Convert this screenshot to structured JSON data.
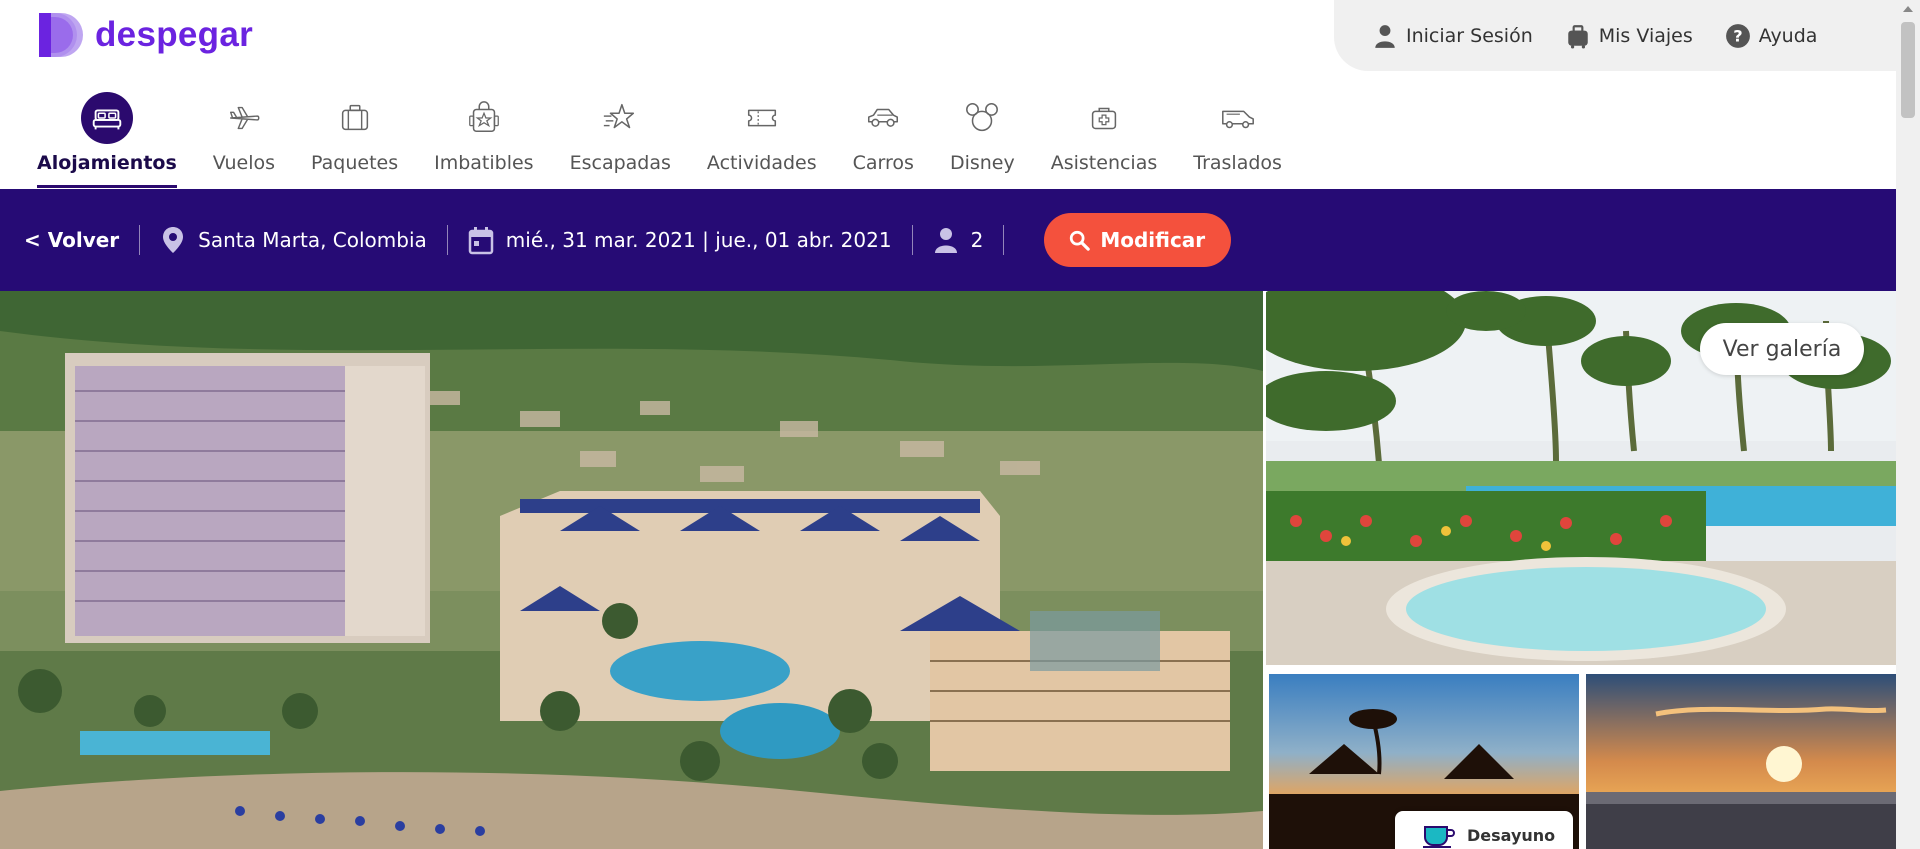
{
  "logo": {
    "text": "despegar"
  },
  "topbar": [
    {
      "label": "Iniciar Sesión",
      "icon": "user-icon"
    },
    {
      "label": "Mis Viajes",
      "icon": "suitcase-icon"
    },
    {
      "label": "Ayuda",
      "icon": "help-icon"
    }
  ],
  "nav": [
    {
      "label": "Alojamientos",
      "icon": "bed-icon",
      "active": true
    },
    {
      "label": "Vuelos",
      "icon": "plane-icon"
    },
    {
      "label": "Paquetes",
      "icon": "luggage-icon"
    },
    {
      "label": "Imbatibles",
      "icon": "offer-bag-icon"
    },
    {
      "label": "Escapadas",
      "icon": "star-icon"
    },
    {
      "label": "Actividades",
      "icon": "ticket-icon"
    },
    {
      "label": "Carros",
      "icon": "car-icon"
    },
    {
      "label": "Disney",
      "icon": "mickey-icon"
    },
    {
      "label": "Asistencias",
      "icon": "medical-kit-icon"
    },
    {
      "label": "Traslados",
      "icon": "van-icon"
    }
  ],
  "search": {
    "back_label": "< Volver",
    "destination": "Santa Marta, Colombia",
    "dates": "mié., 31 mar. 2021 | jue., 01 abr. 2021",
    "guests": "2",
    "modify_label": "Modificar"
  },
  "gallery": {
    "view_gallery_label": "Ver galería",
    "badge_label": "Desayuno"
  },
  "colors": {
    "brand_purple": "#6b23e0",
    "search_bar": "#260b75",
    "modify_button": "#f4513d",
    "active_nav": "#2b0a6e"
  }
}
